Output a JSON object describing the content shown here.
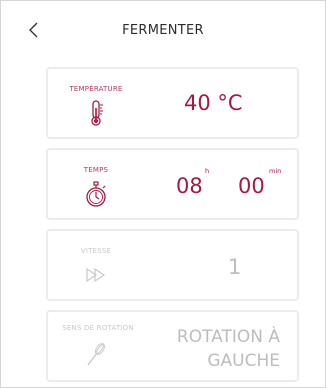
{
  "header": {
    "title": "FERMENTER",
    "back_icon": "chevron-left-icon"
  },
  "cards": {
    "temperature": {
      "label": "TEMPÉRATURE",
      "value": "40 °C",
      "icon": "thermometer-icon"
    },
    "time": {
      "label": "TEMPS",
      "hours": "08",
      "hours_unit": "h",
      "minutes": "00",
      "minutes_unit": "min",
      "icon": "stopwatch-icon"
    },
    "speed": {
      "label": "VITESSE",
      "value": "1",
      "icon": "fast-forward-icon"
    },
    "rotation": {
      "label": "SENS DE ROTATION",
      "value_line1": "ROTATION À",
      "value_line2": "GAUCHE",
      "icon": "whisk-icon"
    }
  },
  "colors": {
    "accent": "#a8193f",
    "label_accent": "#b8385a",
    "disabled": "#c9c9c9",
    "border": "#ececec"
  }
}
